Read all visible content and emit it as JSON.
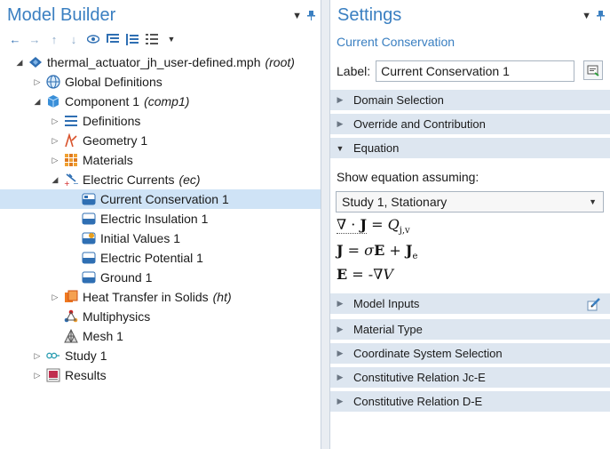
{
  "model_builder": {
    "title": "Model Builder",
    "tree": [
      {
        "level": 0,
        "label": "thermal_actuator_jh_user-defined.mph",
        "tag": "(root)",
        "icon": "mph-file-icon",
        "toggle": "expanded"
      },
      {
        "level": 1,
        "label": "Global Definitions",
        "tag": "",
        "icon": "globe-icon",
        "toggle": "collapsed"
      },
      {
        "level": 1,
        "label": "Component 1",
        "tag": "(comp1)",
        "icon": "component-icon",
        "toggle": "expanded"
      },
      {
        "level": 2,
        "label": "Definitions",
        "tag": "",
        "icon": "definitions-icon",
        "toggle": "collapsed"
      },
      {
        "level": 2,
        "label": "Geometry 1",
        "tag": "",
        "icon": "geometry-icon",
        "toggle": "collapsed"
      },
      {
        "level": 2,
        "label": "Materials",
        "tag": "",
        "icon": "materials-icon",
        "toggle": "collapsed"
      },
      {
        "level": 2,
        "label": "Electric Currents",
        "tag": "(ec)",
        "icon": "electric-currents-icon",
        "toggle": "expanded"
      },
      {
        "level": 3,
        "label": "Current Conservation 1",
        "tag": "",
        "icon": "current-conservation-icon",
        "toggle": "none",
        "selected": true
      },
      {
        "level": 3,
        "label": "Electric Insulation 1",
        "tag": "",
        "icon": "electric-insulation-icon",
        "toggle": "none"
      },
      {
        "level": 3,
        "label": "Initial Values 1",
        "tag": "",
        "icon": "initial-values-icon",
        "toggle": "none"
      },
      {
        "level": 3,
        "label": "Electric Potential 1",
        "tag": "",
        "icon": "electric-potential-icon",
        "toggle": "none"
      },
      {
        "level": 3,
        "label": "Ground 1",
        "tag": "",
        "icon": "ground-icon",
        "toggle": "none"
      },
      {
        "level": 2,
        "label": "Heat Transfer in Solids",
        "tag": "(ht)",
        "icon": "heat-transfer-icon",
        "toggle": "collapsed"
      },
      {
        "level": 2,
        "label": "Multiphysics",
        "tag": "",
        "icon": "multiphysics-icon",
        "toggle": "none"
      },
      {
        "level": 2,
        "label": "Mesh 1",
        "tag": "",
        "icon": "mesh-icon",
        "toggle": "none"
      },
      {
        "level": 1,
        "label": "Study 1",
        "tag": "",
        "icon": "study-icon",
        "toggle": "collapsed"
      },
      {
        "level": 1,
        "label": "Results",
        "tag": "",
        "icon": "results-icon",
        "toggle": "collapsed"
      }
    ]
  },
  "settings": {
    "title": "Settings",
    "subtitle": "Current Conservation",
    "label_caption": "Label:",
    "label_value": "Current Conservation 1",
    "sections_top": [
      {
        "name": "Domain Selection",
        "expanded": false
      },
      {
        "name": "Override and Contribution",
        "expanded": false
      },
      {
        "name": "Equation",
        "expanded": true
      }
    ],
    "equation": {
      "show_assuming": "Show equation assuming:",
      "selected_study": "Study 1, Stationary"
    },
    "sections_bottom": [
      {
        "name": "Model Inputs",
        "expanded": false
      },
      {
        "name": "Material Type",
        "expanded": false
      },
      {
        "name": "Coordinate System Selection",
        "expanded": false
      },
      {
        "name": "Constitutive Relation Jc-E",
        "expanded": false
      },
      {
        "name": "Constitutive Relation D-E",
        "expanded": false
      }
    ]
  },
  "colors": {
    "title": "#3a7fc1",
    "selected_row": "#cfe3f6",
    "section_header": "#dde6f0"
  }
}
